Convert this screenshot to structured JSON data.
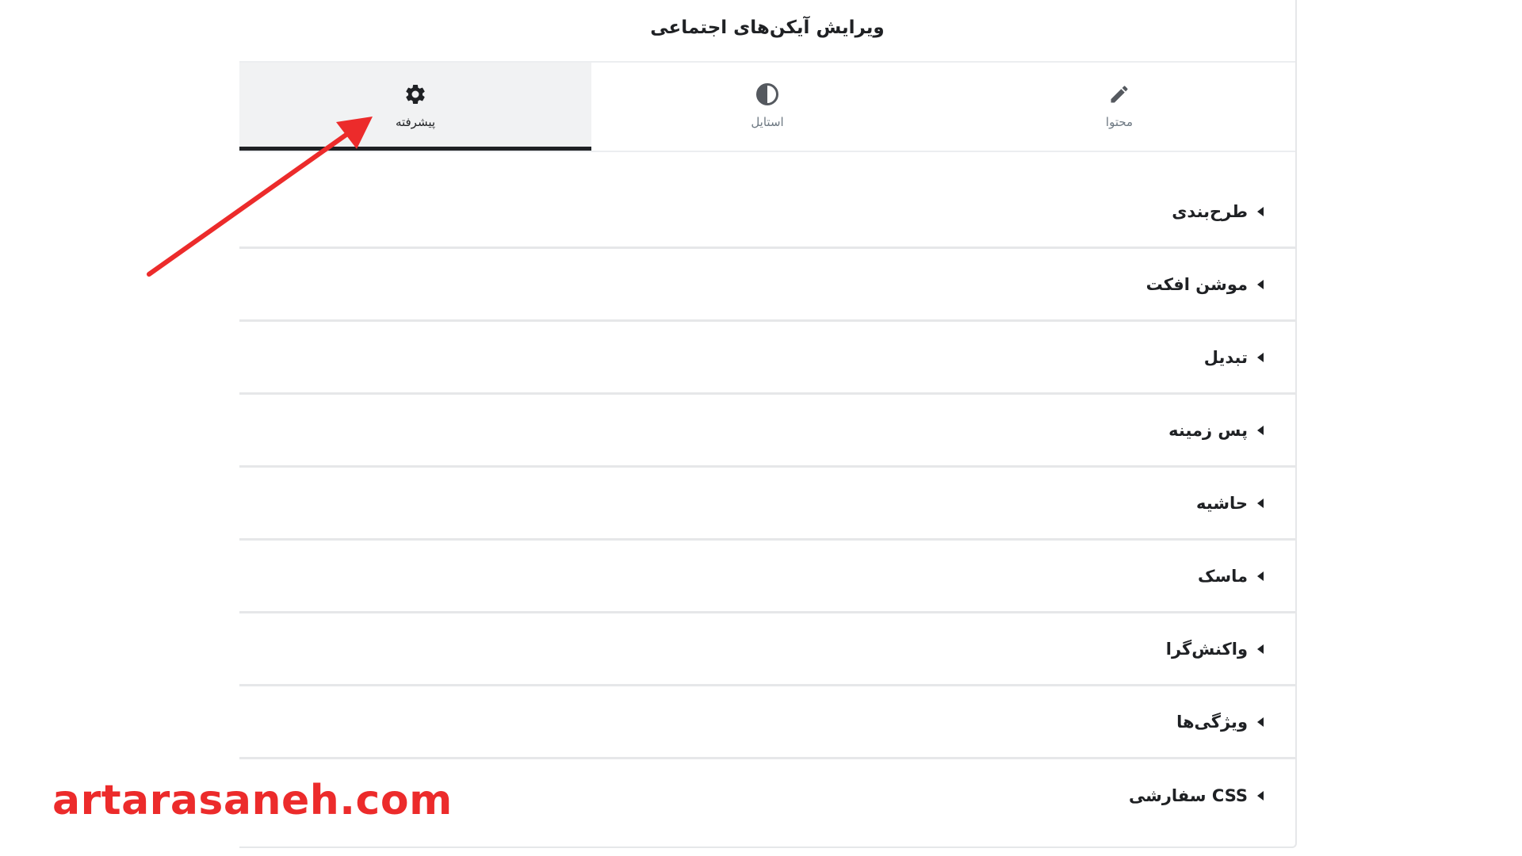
{
  "panel": {
    "title": "ویرایش آیکن‌های اجتماعی"
  },
  "tabs": [
    {
      "label": "محتوا",
      "icon": "pencil-icon",
      "active": false
    },
    {
      "label": "استایل",
      "icon": "contrast-icon",
      "active": false
    },
    {
      "label": "پیشرفته",
      "icon": "gear-icon",
      "active": true
    }
  ],
  "sections": [
    {
      "label": "طرح‌بندی"
    },
    {
      "label": "موشن افکت"
    },
    {
      "label": "تبدیل"
    },
    {
      "label": "پس زمینه"
    },
    {
      "label": "حاشیه"
    },
    {
      "label": "ماسک"
    },
    {
      "label": "واکنش‌گرا"
    },
    {
      "label": "ویژگی‌ها"
    },
    {
      "label": "CSS سفارشی"
    }
  ],
  "watermark": {
    "text": "artarasaneh.com"
  },
  "colors": {
    "accent": "#ec2b2b",
    "text": "#1f2124",
    "active_tab_bg": "#f1f2f3",
    "muted": "#6d7882"
  }
}
